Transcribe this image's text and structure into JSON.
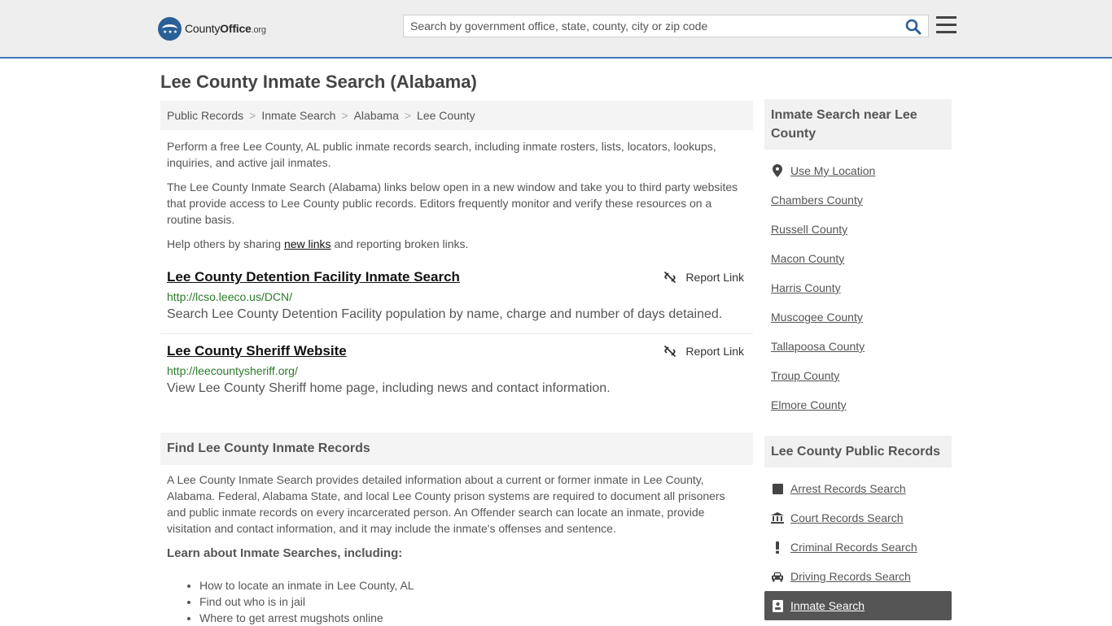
{
  "header": {
    "logo_prefix": "County",
    "logo_bold": "Office",
    "logo_suffix": ".org",
    "search_placeholder": "Search by government office, state, county, city or zip code"
  },
  "page_title": "Lee County Inmate Search (Alabama)",
  "breadcrumb": [
    "Public Records",
    "Inmate Search",
    "Alabama",
    "Lee County"
  ],
  "intro": {
    "p1": "Perform a free Lee County, AL public inmate records search, including inmate rosters, lists, locators, lookups, inquiries, and active jail inmates.",
    "p2": "The Lee County Inmate Search (Alabama) links below open in a new window and take you to third party websites that provide access to Lee County public records. Editors frequently monitor and verify these resources on a routine basis.",
    "p3_before": "Help others by sharing ",
    "p3_link": "new links",
    "p3_after": " and reporting broken links."
  },
  "results": [
    {
      "title": "Lee County Detention Facility Inmate Search",
      "url": "http://lcso.leeco.us/DCN/",
      "desc": "Search Lee County Detention Facility population by name, charge and number of days detained.",
      "report": "Report Link"
    },
    {
      "title": "Lee County Sheriff Website",
      "url": "http://leecountysheriff.org/",
      "desc": "View Lee County Sheriff home page, including news and contact information.",
      "report": "Report Link"
    }
  ],
  "find_section": {
    "heading": "Find Lee County Inmate Records",
    "para": "A Lee County Inmate Search provides detailed information about a current or former inmate in Lee County, Alabama. Federal, Alabama State, and local Lee County prison systems are required to document all prisoners and public inmate records on every incarcerated person. An Offender search can locate an inmate, provide visitation and contact information, and it may include the inmate's offenses and sentence.",
    "learn": "Learn about Inmate Searches, including:",
    "bullets": [
      "How to locate an inmate in Lee County, AL",
      "Find out who is in jail",
      "Where to get arrest mugshots online"
    ]
  },
  "sidebar": {
    "near_heading": "Inmate Search near Lee County",
    "use_location": "Use My Location",
    "counties": [
      "Chambers County",
      "Russell County",
      "Macon County",
      "Harris County",
      "Muscogee County",
      "Tallapoosa County",
      "Troup County",
      "Elmore County"
    ],
    "records_heading": "Lee County Public Records",
    "records": [
      {
        "label": "Arrest Records Search",
        "icon": "square-icon"
      },
      {
        "label": "Court Records Search",
        "icon": "courthouse-icon"
      },
      {
        "label": "Criminal Records Search",
        "icon": "exclamation-icon"
      },
      {
        "label": "Driving Records Search",
        "icon": "car-icon"
      },
      {
        "label": "Inmate Search",
        "icon": "id-badge-icon"
      }
    ]
  },
  "colors": {
    "accent_border": "#3e79b8",
    "link_green": "#2b7b2b",
    "active_bg": "#555555"
  }
}
